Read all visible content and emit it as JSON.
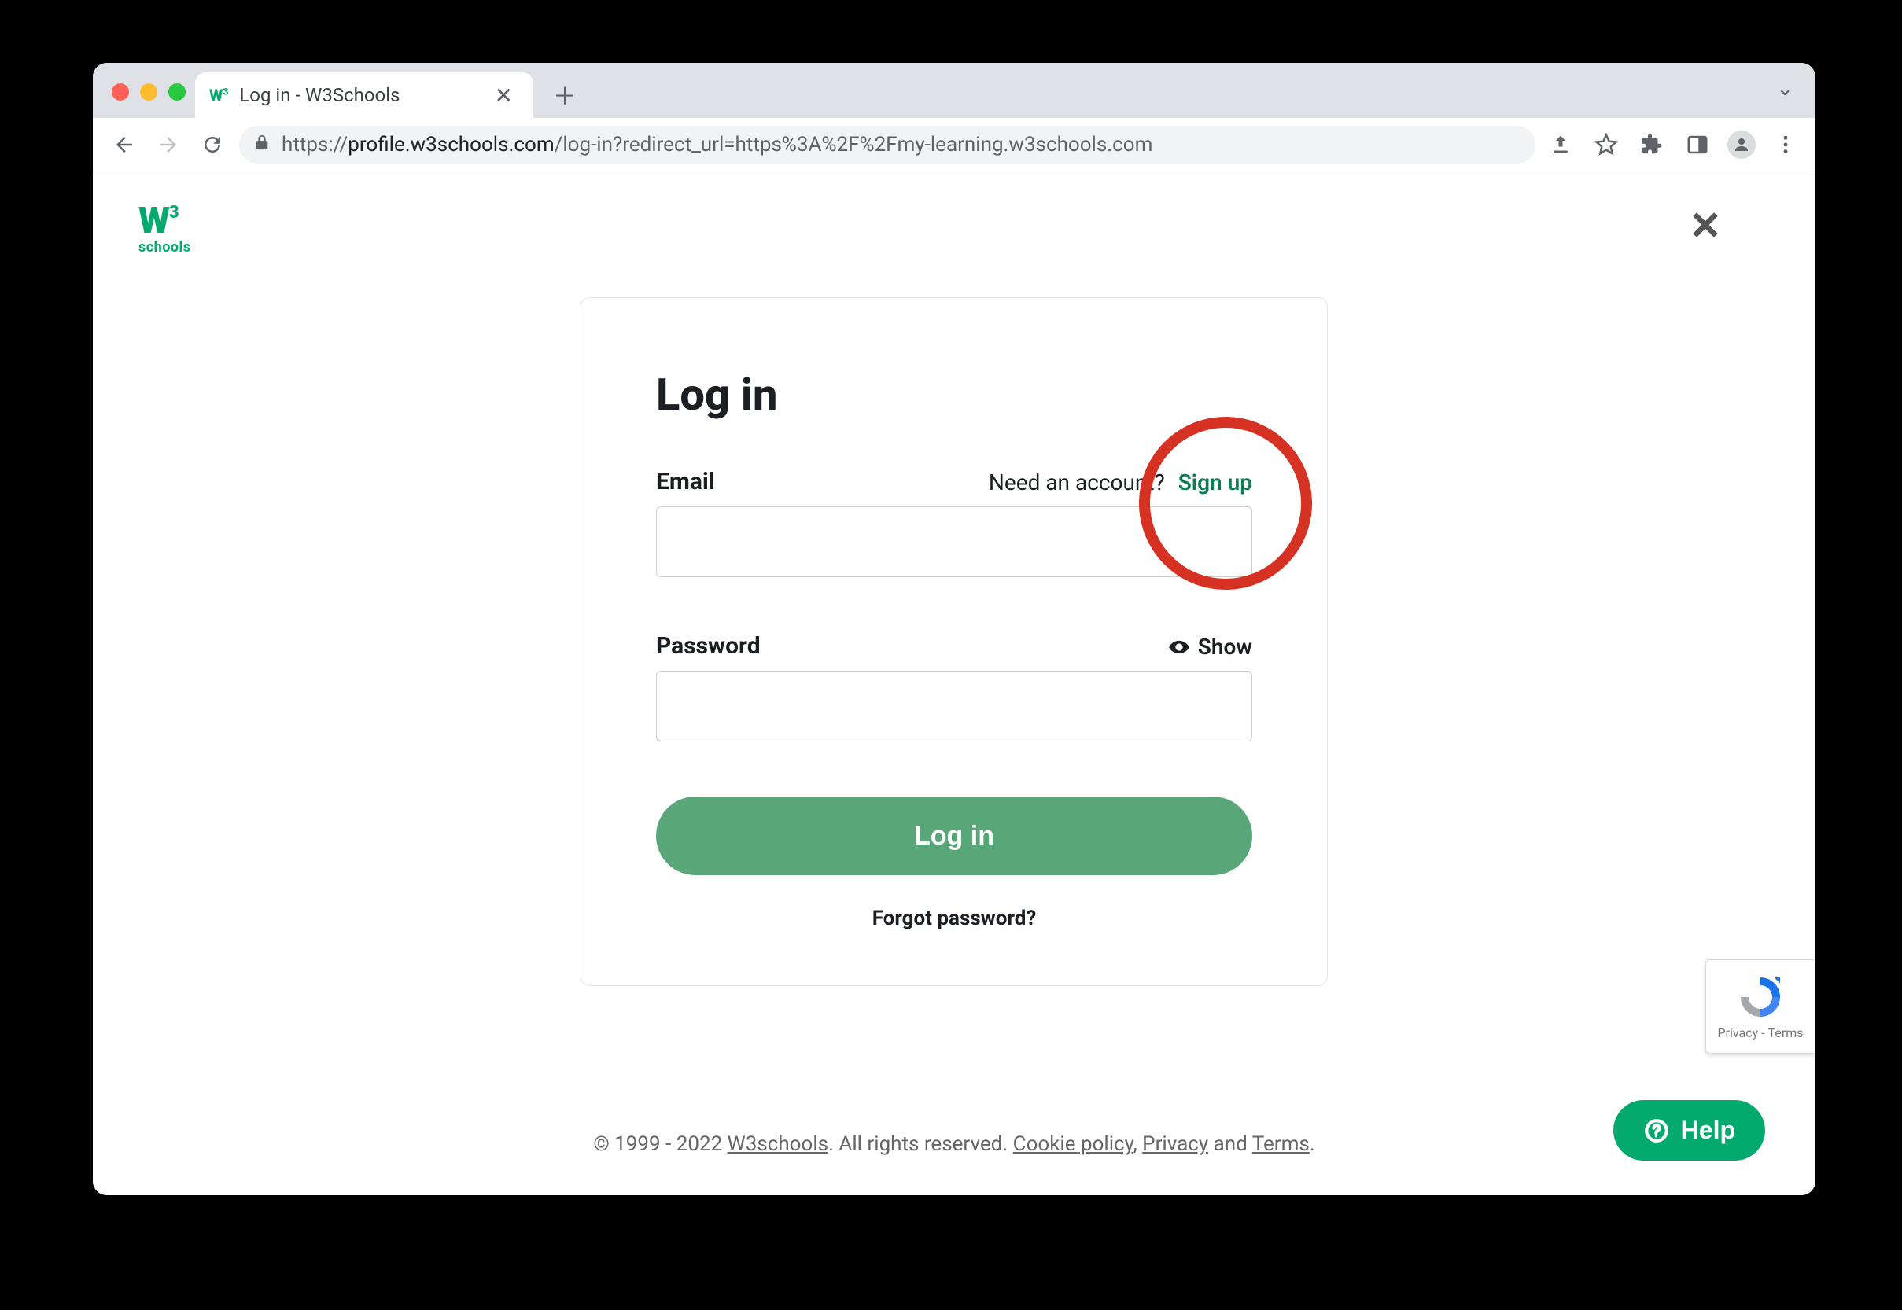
{
  "browser": {
    "tab_title": "Log in - W3Schools",
    "url_proto": "https://",
    "url_host": "profile.w3schools.com",
    "url_path": "/log-in?redirect_url=https%3A%2F%2Fmy-learning.w3schools.com"
  },
  "logo": {
    "mark": "W",
    "exponent": "3",
    "sub": "schools"
  },
  "form": {
    "title": "Log in",
    "email_label": "Email",
    "need_account": "Need an account?",
    "signup": "Sign up",
    "password_label": "Password",
    "show": "Show",
    "submit": "Log in",
    "forgot": "Forgot password?",
    "email_value": "",
    "password_value": ""
  },
  "footer": {
    "copyright_prefix": "© 1999 - 2022 ",
    "brand": "W3schools",
    "rights": ". All rights reserved. ",
    "cookie": "Cookie policy",
    "comma": ", ",
    "privacy": "Privacy",
    "and": " and ",
    "terms": "Terms",
    "period": "."
  },
  "help": {
    "label": "Help"
  },
  "recaptcha": {
    "privacy": "Privacy",
    "terms": "Terms"
  }
}
